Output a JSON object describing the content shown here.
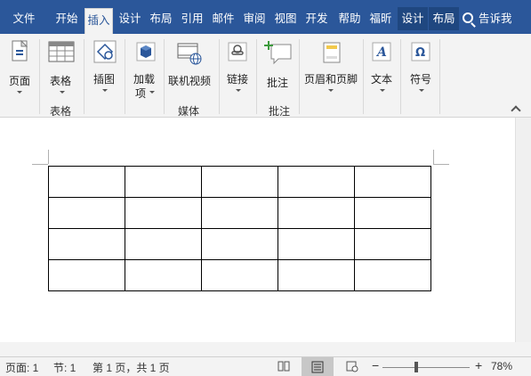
{
  "tabs": [
    "文件",
    "开始",
    "插入",
    "设计",
    "布局",
    "引用",
    "邮件",
    "审阅",
    "视图",
    "开发",
    "帮助",
    "福昕",
    "设计",
    "布局"
  ],
  "active_tab": "插入",
  "search": {
    "label": "告诉我"
  },
  "ribbon": {
    "pages": {
      "label": "页面"
    },
    "table": {
      "label": "表格",
      "group": "表格"
    },
    "illustrations": {
      "label": "插图"
    },
    "addins": {
      "label1": "加载",
      "label2": "项"
    },
    "online_video": {
      "label": "联机视频",
      "group": "媒体"
    },
    "link": {
      "label": "链接"
    },
    "comment": {
      "label": "批注",
      "group": "批注"
    },
    "header_footer": {
      "label": "页眉和页脚"
    },
    "text": {
      "label": "文本"
    },
    "symbols": {
      "label": "符号"
    }
  },
  "document": {
    "table": {
      "rows": 4,
      "cols": 5
    }
  },
  "status": {
    "page": "页面: 1",
    "section": "节: 1",
    "page_of": "第 1 页，共 1 页",
    "zoom": "78%",
    "zoom_minus": "−",
    "zoom_plus": "+"
  },
  "colors": {
    "accent": "#2b579a",
    "ribbon_bg": "#f3f3f3",
    "context_tab": "#1f4780"
  }
}
